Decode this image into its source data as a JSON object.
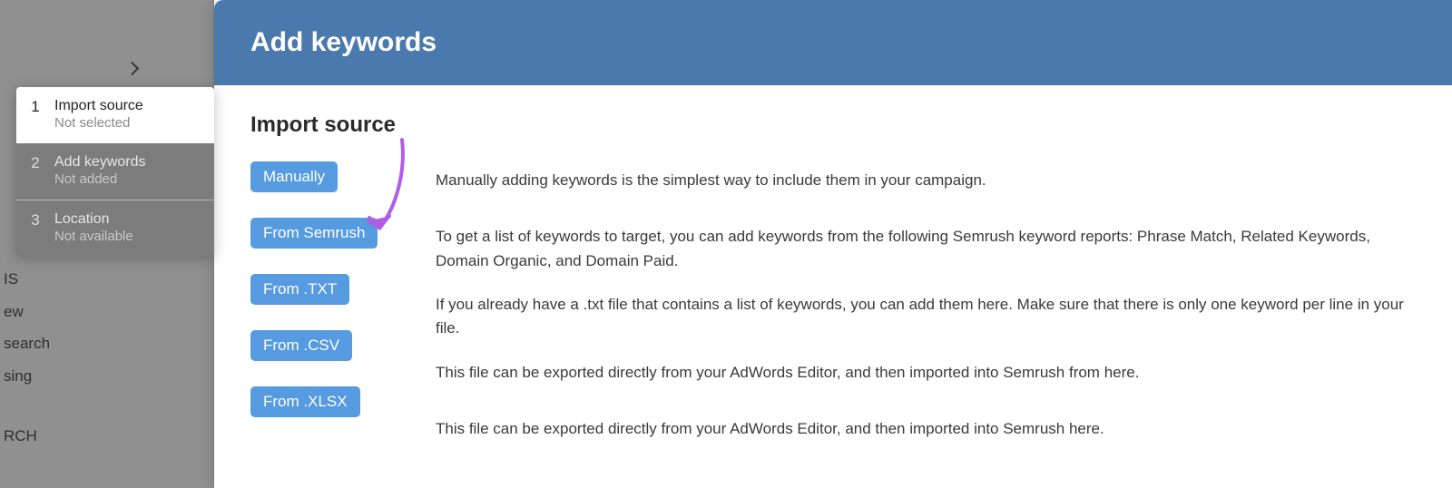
{
  "bg_nav": [
    "IS",
    "ew",
    "search",
    "sing",
    "RCH"
  ],
  "modal": {
    "title": "Add keywords",
    "section_title": "Import source"
  },
  "steps": [
    {
      "num": "1",
      "title": "Import source",
      "sub": "Not selected"
    },
    {
      "num": "2",
      "title": "Add keywords",
      "sub": "Not added"
    },
    {
      "num": "3",
      "title": "Location",
      "sub": "Not available"
    }
  ],
  "options": [
    {
      "label": "Manually",
      "desc": "Manually adding keywords is the simplest way to include them in your campaign."
    },
    {
      "label": "From Semrush",
      "desc": "To get a list of keywords to target, you can add keywords from the following Semrush keyword reports: Phrase Match, Related Keywords, Domain Organic, and Domain Paid."
    },
    {
      "label": "From .TXT",
      "desc": "If you already have a .txt file that contains a list of keywords, you can add them here. Make sure that there is only one keyword per line in your file."
    },
    {
      "label": "From .CSV",
      "desc": "This file can be exported directly from your AdWords Editor, and then imported into Semrush from here."
    },
    {
      "label": "From .XLSX",
      "desc": "This file can be exported directly from your AdWords Editor, and then imported into Semrush here."
    }
  ],
  "colors": {
    "header": "#4a79ad",
    "button": "#569ae0",
    "arrow": "#b05ee6"
  }
}
